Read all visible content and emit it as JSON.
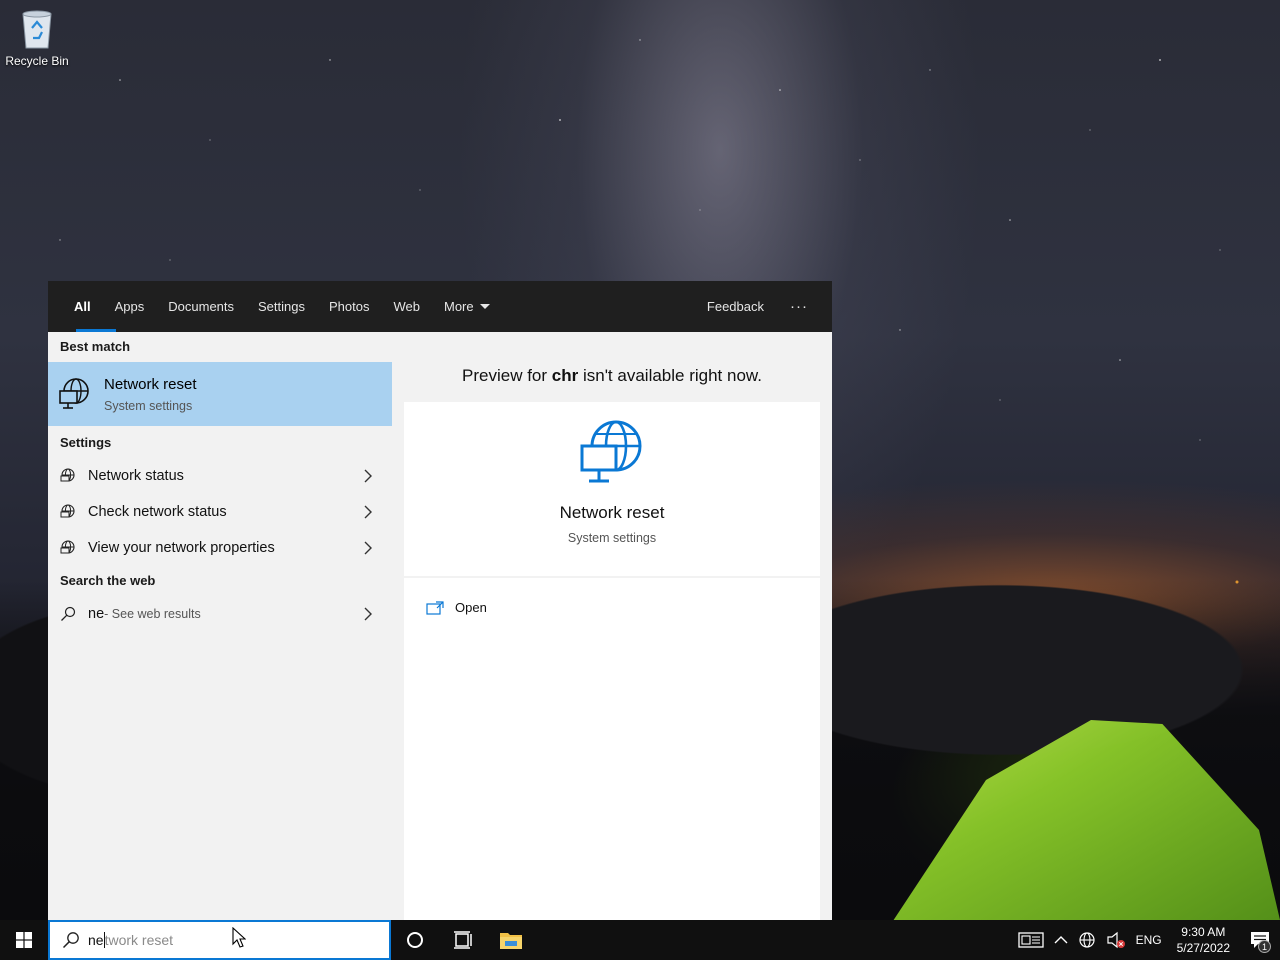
{
  "desktop": {
    "icons": [
      {
        "label": "Recycle Bin",
        "icon": "recycle-bin-icon"
      }
    ]
  },
  "search_panel": {
    "tabs": [
      {
        "label": "All",
        "active": true
      },
      {
        "label": "Apps"
      },
      {
        "label": "Documents"
      },
      {
        "label": "Settings"
      },
      {
        "label": "Photos"
      },
      {
        "label": "Web"
      },
      {
        "label": "More"
      }
    ],
    "feedback_label": "Feedback",
    "more_options_label": "···",
    "best_match": {
      "heading": "Best match",
      "title": "Network reset",
      "subtitle": "System settings",
      "icon": "network-globe-icon"
    },
    "settings": {
      "heading": "Settings",
      "items": [
        {
          "label": "Network status",
          "icon": "globe-icon"
        },
        {
          "label": "Check network status",
          "icon": "globe-icon"
        },
        {
          "label": "View your network properties",
          "icon": "globe-icon"
        }
      ]
    },
    "web": {
      "heading": "Search the web",
      "query": "ne",
      "suffix": " - See web results",
      "icon": "search-icon"
    },
    "preview": {
      "message_prefix": "Preview for ",
      "message_bold": "chr",
      "message_suffix": " isn't available right now.",
      "title": "Network reset",
      "subtitle": "System settings",
      "open_label": "Open"
    }
  },
  "taskbar": {
    "search_typed": "ne",
    "search_ghost": "twork reset",
    "language": "ENG",
    "time": "9:30 AM",
    "date": "5/27/2022",
    "notification_count": "1"
  },
  "colors": {
    "accent": "#0a78d4",
    "best_match_bg": "#a9d1f0",
    "topbar_bg": "#1f1f1f",
    "taskbar_bg": "#101010"
  }
}
